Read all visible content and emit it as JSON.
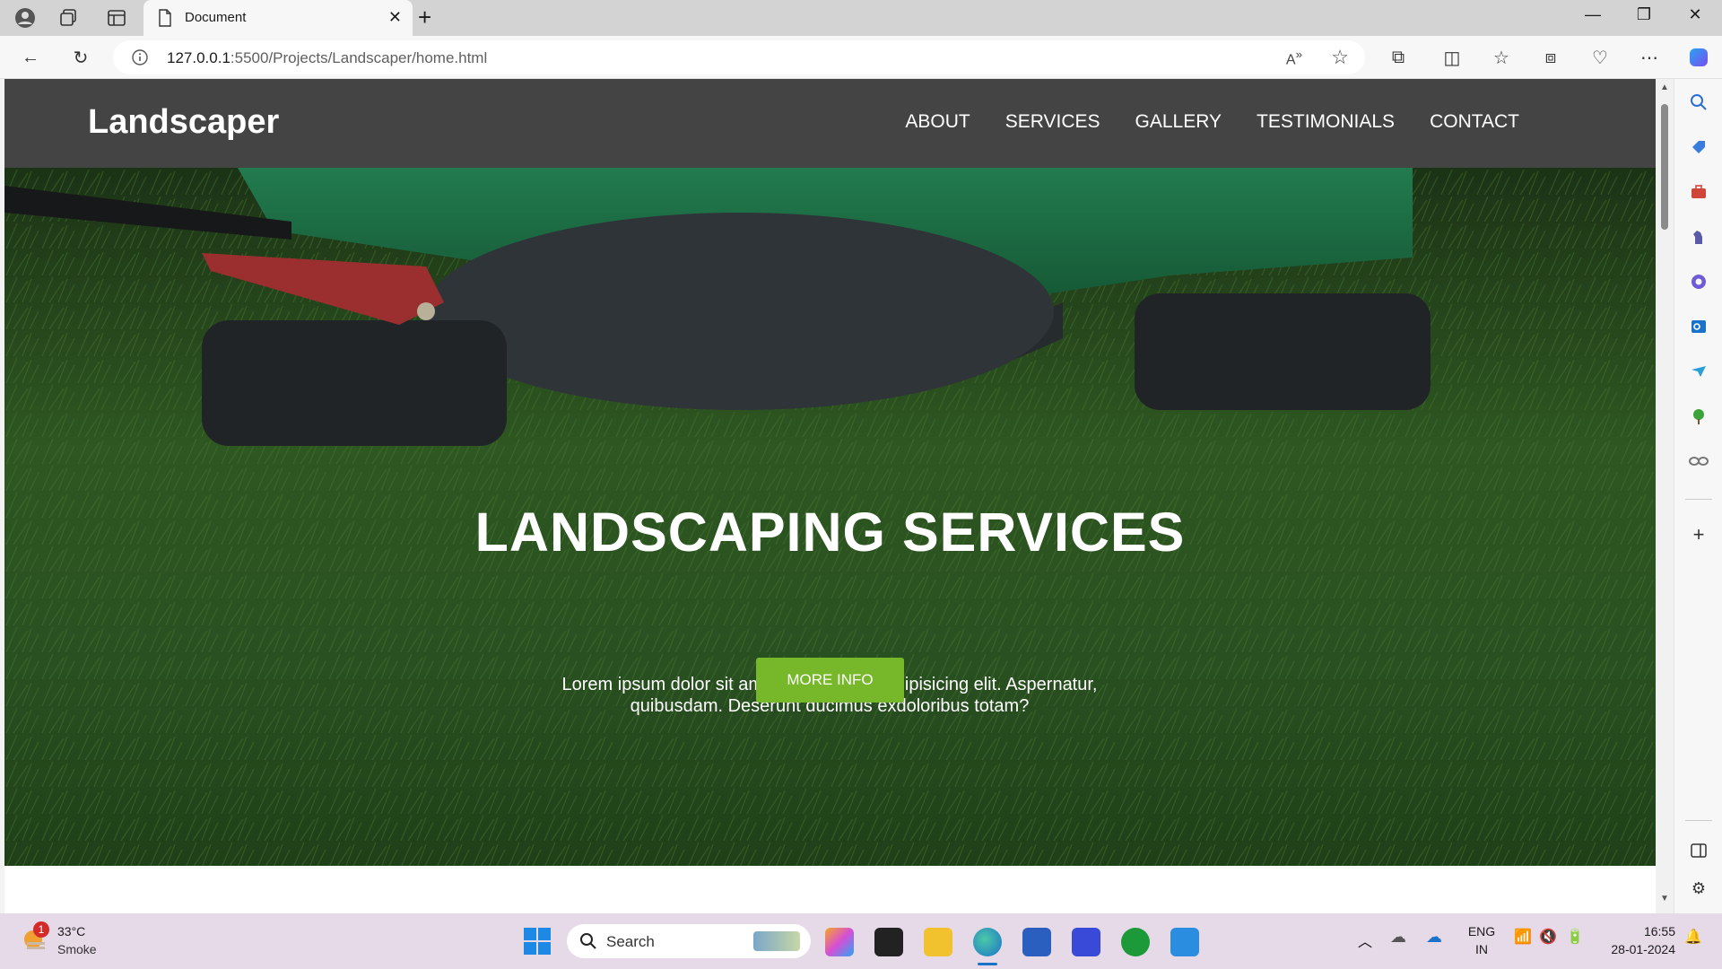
{
  "browser": {
    "tab_title": "Document",
    "url_host": "127.0.0.1",
    "url_rest": ":5500/Projects/Landscaper/home.html"
  },
  "site": {
    "brand": "Landscaper",
    "nav": [
      "ABOUT",
      "SERVICES",
      "GALLERY",
      "TESTIMONIALS",
      "CONTACT"
    ],
    "hero_title": "LANDSCAPING SERVICES",
    "hero_text": "Lorem ipsum dolor sit amet consectetur, adipisicing elit. Aspernatur, quibusdam. Deserunt ducimus exdoloribus totam?",
    "hero_button": "MORE INFO"
  },
  "taskbar": {
    "weather_temp": "33°C",
    "weather_desc": "Smoke",
    "weather_badge": "1",
    "search_label": "Search",
    "lang_line1": "ENG",
    "lang_line2": "IN",
    "time": "16:55",
    "date": "28-01-2024"
  },
  "colors": {
    "nav_bg": "#444444",
    "button_green": "#76b82a",
    "taskbar_bg": "#e6d9e8"
  }
}
